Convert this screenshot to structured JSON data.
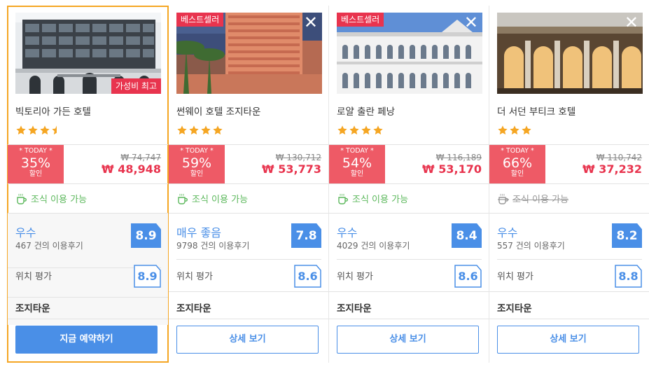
{
  "colors": {
    "accent": "#4a8fe7",
    "discount": "#e8344e",
    "today_bg": "#ee5a66",
    "selected_border": "#f5a623",
    "breakfast": "#5cb85c",
    "star": "#f5a623"
  },
  "hotels": [
    {
      "ribbon": "",
      "badge": "가성비 최고",
      "close_icon": "",
      "name": "빅토리아 가든 호텔",
      "stars": 3.5,
      "today_label": "* TODAY *",
      "discount": "35%",
      "discount_word": "할인",
      "old_price": "₩ 74,747",
      "new_price": "₩ 48,948",
      "breakfast": "조식 이용 가능",
      "breakfast_available": true,
      "rating_label": "우수",
      "reviews": "467 건의 이용후기",
      "score": "8.9",
      "location_label": "위치 평가",
      "location_score": "8.9",
      "area": "조지타운",
      "button": "지금 예약하기"
    },
    {
      "ribbon": "베스트셀러",
      "badge": "",
      "close_icon": "✕",
      "name": "썬웨이 호텔 조지타운",
      "stars": 4,
      "today_label": "* TODAY *",
      "discount": "59%",
      "discount_word": "할인",
      "old_price": "₩ 130,712",
      "new_price": "₩ 53,773",
      "breakfast": "조식 이용 가능",
      "breakfast_available": true,
      "rating_label": "매우 좋음",
      "reviews": "9798 건의 이용후기",
      "score": "7.8",
      "location_label": "위치 평가",
      "location_score": "8.6",
      "area": "조지타운",
      "button": "상세 보기"
    },
    {
      "ribbon": "베스트셀러",
      "badge": "",
      "close_icon": "✕",
      "name": "로얄 출란 페낭",
      "stars": 4,
      "today_label": "* TODAY *",
      "discount": "54%",
      "discount_word": "할인",
      "old_price": "₩ 116,189",
      "new_price": "₩ 53,170",
      "breakfast": "조식 이용 가능",
      "breakfast_available": true,
      "rating_label": "우수",
      "reviews": "4029 건의 이용후기",
      "score": "8.4",
      "location_label": "위치 평가",
      "location_score": "8.6",
      "area": "조지타운",
      "button": "상세 보기"
    },
    {
      "ribbon": "",
      "badge": "",
      "close_icon": "✕",
      "name": "더 서던 부티크 호텔",
      "stars": 3,
      "today_label": "* TODAY *",
      "discount": "66%",
      "discount_word": "할인",
      "old_price": "₩ 110,742",
      "new_price": "₩ 37,232",
      "breakfast": "조식 이용 가능",
      "breakfast_available": false,
      "rating_label": "우수",
      "reviews": "557 건의 이용후기",
      "score": "8.2",
      "location_label": "위치 평가",
      "location_score": "8.8",
      "area": "조지타운",
      "button": "상세 보기"
    }
  ]
}
